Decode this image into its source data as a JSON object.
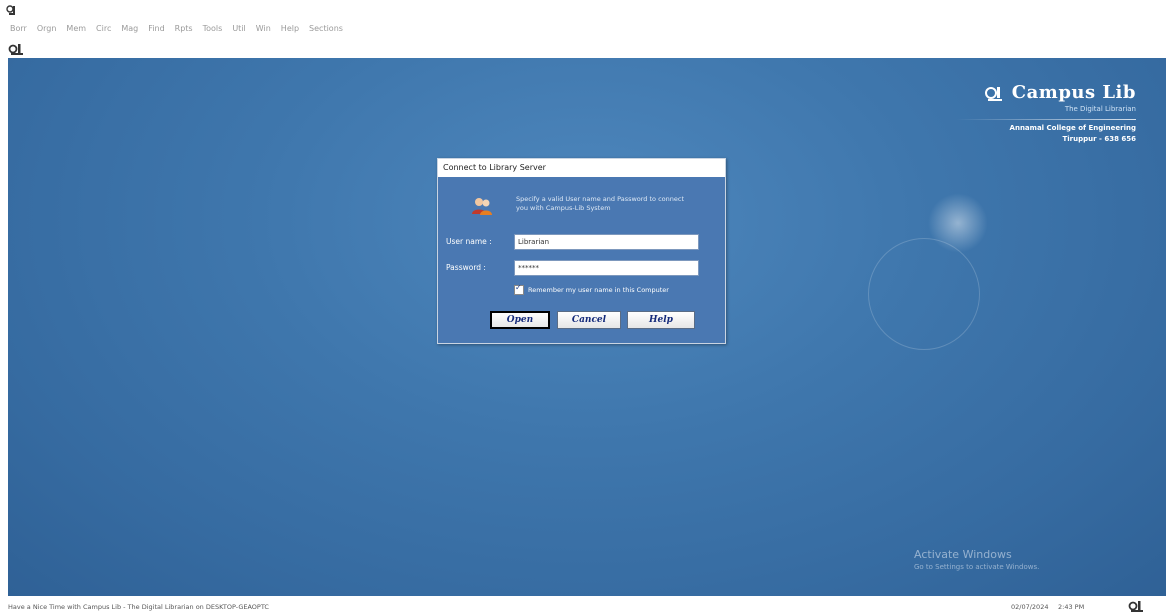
{
  "menubar": {
    "items": [
      "Borr",
      "Orgn",
      "Mem",
      "Circ",
      "Mag",
      "Find",
      "Rpts",
      "Tools",
      "Util",
      "Win",
      "Help",
      "Sections"
    ]
  },
  "brand": {
    "name": "Campus Lib",
    "tagline": "The Digital Librarian",
    "college": "Annamal College of Engineering",
    "city": "Tiruppur - 638 656"
  },
  "dialog": {
    "title": "Connect to Library Server",
    "message": "Specify a valid User name and Password to connect you with Campus-Lib System",
    "username_label": "User name :",
    "username_value": "Librarian",
    "password_label": "Password :",
    "password_value": "******",
    "remember_label": "Remember my user name in this Computer",
    "remember_checked": true,
    "open_label": "Open",
    "cancel_label": "Cancel",
    "help_label": "Help"
  },
  "watermark": {
    "line1": "Activate Windows",
    "line2": "Go to Settings to activate Windows."
  },
  "statusbar": {
    "message": "Have a Nice Time with Campus Lib - The Digital Librarian on DESKTOP-GEAOPTC",
    "date": "02/07/2024",
    "time": "2:43 PM"
  },
  "colors": {
    "desktop": "#3f77ad",
    "dialog": "#4a78b2",
    "button_text": "#13297a"
  },
  "icons": [
    "app-logo-icon",
    "user-group-icon",
    "checkbox-check-icon"
  ]
}
